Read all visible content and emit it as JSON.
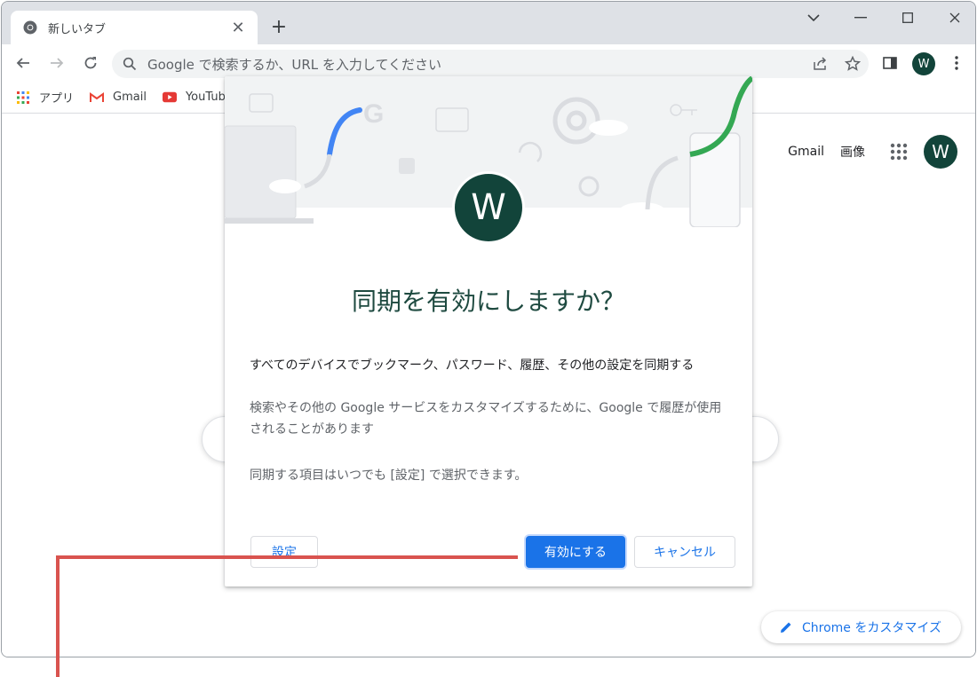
{
  "tab": {
    "title": "新しいタブ"
  },
  "omnibox": {
    "placeholder": "Google で検索するか、URL を入力してください"
  },
  "profile": {
    "initial": "W"
  },
  "bookmarks": [
    {
      "label": "アプリ",
      "icon": "apps-grid-icon"
    },
    {
      "label": "Gmail",
      "icon": "gmail-icon"
    },
    {
      "label": "YouTube",
      "icon": "youtube-icon"
    }
  ],
  "page": {
    "links": {
      "gmail": "Gmail",
      "images": "画像"
    },
    "avatar_initial": "W",
    "customize_label": "Chrome をカスタマイズ"
  },
  "dialog": {
    "avatar_initial": "W",
    "title": "同期を有効にしますか？",
    "line1": "すべてのデバイスでブックマーク、パスワード、履歴、その他の設定を同期する",
    "line2": "検索やその他の Google サービスをカスタマイズするために、Google で履歴が使用されることがあります",
    "line3": "同期する項目はいつでも [設定] で選択できます。",
    "buttons": {
      "settings": "設定",
      "enable": "有効にする",
      "cancel": "キャンセル"
    }
  },
  "colors": {
    "accent": "#1a73e8",
    "avatar": "#12443a",
    "annotation": "#d9534f",
    "title": "#1e4a40"
  }
}
